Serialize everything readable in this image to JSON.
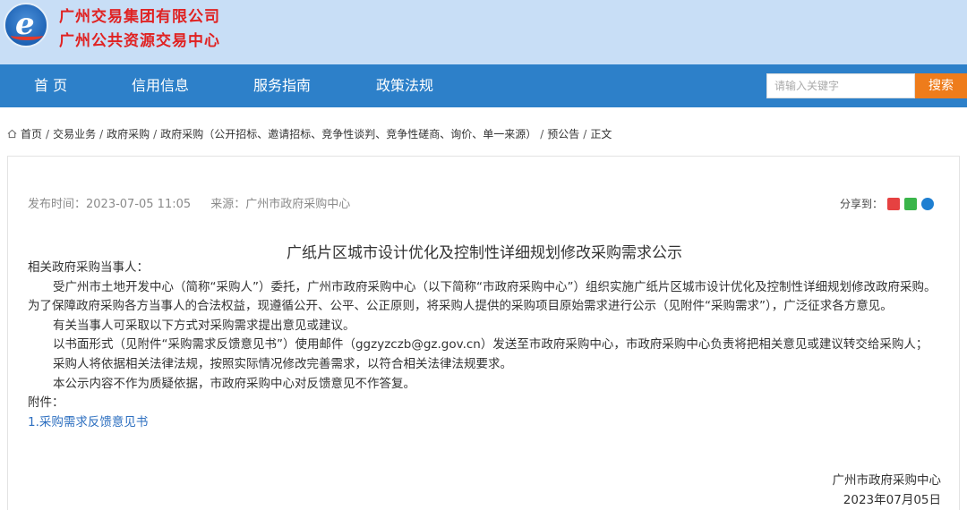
{
  "header": {
    "org_name_1": "广州交易集团有限公司",
    "org_name_2": "广州公共资源交易中心",
    "logo_letter": "e"
  },
  "nav": {
    "items": [
      "首 页",
      "信用信息",
      "服务指南",
      "政策法规"
    ],
    "search_placeholder": "请输入关键字",
    "search_button": "搜索"
  },
  "breadcrumb": {
    "items": [
      "首页",
      "交易业务",
      "政府采购",
      "政府采购（公开招标、邀请招标、竞争性谈判、竞争性磋商、询价、单一来源）",
      "预公告",
      "正文"
    ]
  },
  "article": {
    "publish_time": "发布时间：2023-07-05 11:05",
    "source": "来源：广州市政府采购中心",
    "share_label": "分享到：",
    "title": "广纸片区城市设计优化及控制性详细规划修改采购需求公示",
    "salutation": "相关政府采购当事人：",
    "paragraphs": [
      "受广州市土地开发中心（简称“采购人”）委托，广州市政府采购中心（以下简称“市政府采购中心”）组织实施广纸片区城市设计优化及控制性详细规划修改政府采购。为了保障政府采购各方当事人的合法权益，现遵循公开、公平、公正原则，将采购人提供的采购项目原始需求进行公示（见附件“采购需求”），广泛征求各方意见。",
      "有关当事人可采取以下方式对采购需求提出意见或建议。",
      "以书面形式（见附件“采购需求反馈意见书”）使用邮件（ggzyzczb@gz.gov.cn）发送至市政府采购中心，市政府采购中心负责将把相关意见或建议转交给采购人；",
      "采购人将依据相关法律法规，按照实际情况修改完善需求，以符合相关法律法规要求。",
      "本公示内容不作为质疑依据，市政府采购中心对反馈意见不作答复。"
    ],
    "attachment_label": "附件：",
    "attachment_link": "1.采购需求反馈意见书",
    "signature_org": "广州市政府采购中心",
    "signature_date": "2023年07月05日"
  },
  "colors": {
    "header_bg": "#c8def6",
    "nav_bg": "#2d80c9",
    "org_text": "#e02222",
    "search_button": "#ee7c1b",
    "link": "#2d6fc0"
  },
  "icons": {
    "logo": "e-logo-icon",
    "home": "home-icon",
    "share": [
      "weibo-icon",
      "wechat-icon",
      "qq-icon"
    ]
  }
}
